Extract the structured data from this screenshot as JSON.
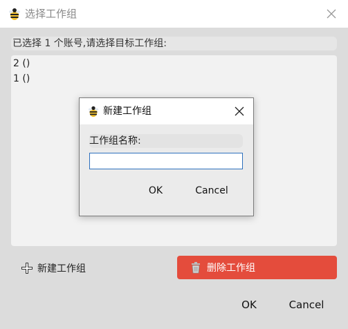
{
  "dialog": {
    "title": "选择工作组",
    "info": "已选择 1 个账号,请选择目标工作组:",
    "groups": [
      "2 ()",
      "1 ()"
    ],
    "new_group_label": "新建工作组",
    "delete_group_label": "删除工作组",
    "ok_label": "OK",
    "cancel_label": "Cancel",
    "delete_color": "#e44c3c"
  },
  "modal": {
    "title": "新建工作组",
    "field_label": "工作组名称:",
    "field_value": "",
    "ok_label": "OK",
    "cancel_label": "Cancel"
  },
  "icons": {
    "app": "bee-icon",
    "close": "close-icon",
    "add": "plus-icon",
    "delete": "trash-icon"
  }
}
